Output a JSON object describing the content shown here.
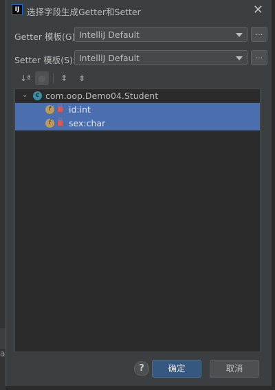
{
  "dialog": {
    "title": "选择字段生成Getter和Setter",
    "app_icon_text": "IJ"
  },
  "getter": {
    "label": "Getter 模板(G):",
    "value": "IntelliJ Default",
    "more": "..."
  },
  "setter": {
    "label": "Setter 模板(S):",
    "value": "IntelliJ Default",
    "more": "..."
  },
  "toolbar": {
    "sort": "↓ª",
    "expand": "⇞",
    "collapse": "⇟"
  },
  "tree": {
    "root": {
      "icon_letter": "c",
      "label": "com.oop.Demo04.Student",
      "expanded": true
    },
    "fields": [
      {
        "icon_letter": "f",
        "label": "id:int",
        "selected": true
      },
      {
        "icon_letter": "f",
        "label": "sex:char",
        "selected": true
      }
    ]
  },
  "footer": {
    "help": "?",
    "ok_label": "确定",
    "cancel_label": "取消"
  },
  "colors": {
    "selection": "#4b6eaf",
    "panel": "#3c3f41",
    "tree_bg": "#2b2b2b",
    "ok_button": "#365880"
  },
  "background": {
    "left_letter": "a"
  }
}
